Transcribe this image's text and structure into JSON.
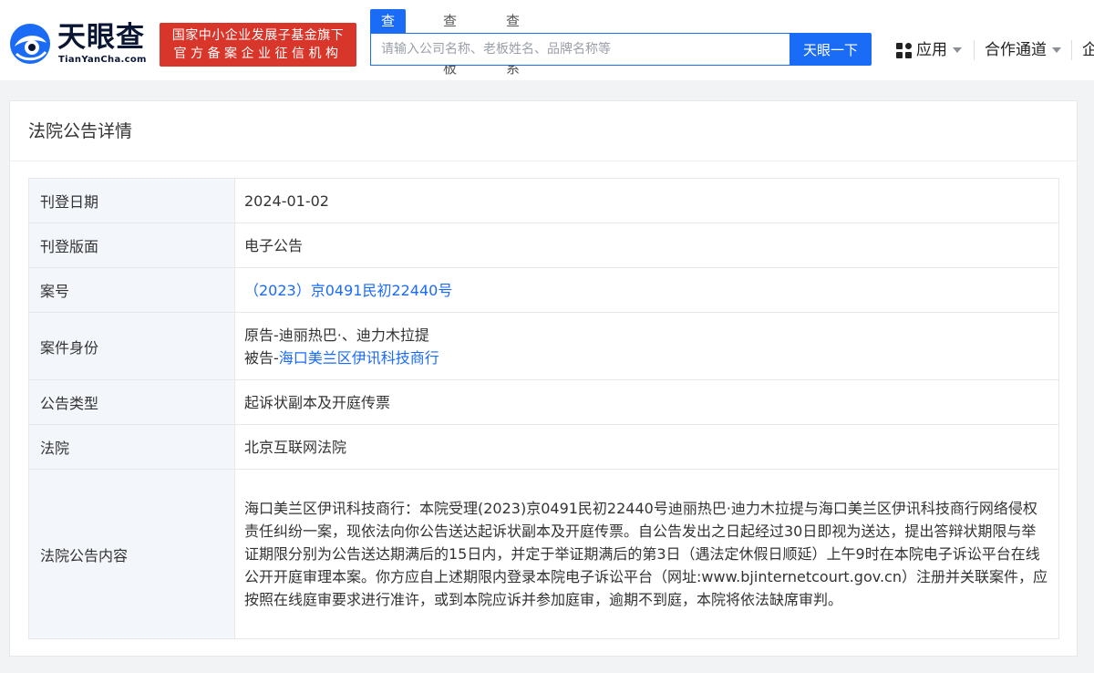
{
  "header": {
    "logo_text": "天眼查",
    "logo_sub": "TianYanCha.com",
    "badge_line1": "国家中小企业发展子基金旗下",
    "badge_line2": "官方备案企业征信机构",
    "search_tabs": [
      "查公司",
      "查老板",
      "查关系"
    ],
    "search_placeholder": "请输入公司名称、老板姓名、品牌名称等",
    "search_button": "天眼一下",
    "nav_app": "应用",
    "nav_coop": "合作通道",
    "nav_ent": "企"
  },
  "card": {
    "title": "法院公告详情",
    "rows": [
      {
        "label": "刊登日期",
        "value": "2024-01-02"
      },
      {
        "label": "刊登版面",
        "value": "电子公告"
      },
      {
        "label": "案号",
        "value": "（2023）京0491民初22440号"
      },
      {
        "label": "案件身份",
        "plaintiff_prefix": "原告-",
        "plaintiff": "迪丽热巴·、迪力木拉提",
        "defendant_prefix": "被告-",
        "defendant": "海口美兰区伊讯科技商行"
      },
      {
        "label": "公告类型",
        "value": "起诉状副本及开庭传票"
      },
      {
        "label": "法院",
        "value": "北京互联网法院"
      },
      {
        "label": "法院公告内容",
        "value": "海口美兰区伊讯科技商行：本院受理(2023)京0491民初22440号迪丽热巴·迪力木拉提与海口美兰区伊讯科技商行网络侵权责任纠纷一案，现依法向你公告送达起诉状副本及开庭传票。自公告发出之日起经过30日即视为送达，提出答辩状期限与举证期限分别为公告送达期满后的15日内，并定于举证期满后的第3日（遇法定休假日顺延）上午9时在本院电子诉讼平台在线公开开庭审理本案。你方应自上述期限内登录本院电子诉讼平台（网址:www.bjinternetcourt.gov.cn）注册并关联案件，应按照在线庭审要求进行准许，或到本院应诉并参加庭审，逾期不到庭，本院将依法缺席审判。"
      }
    ]
  },
  "colors": {
    "brand_blue": "#1a6bf5",
    "badge_red": "#d8362b",
    "key_bg": "#f3f6fa"
  }
}
